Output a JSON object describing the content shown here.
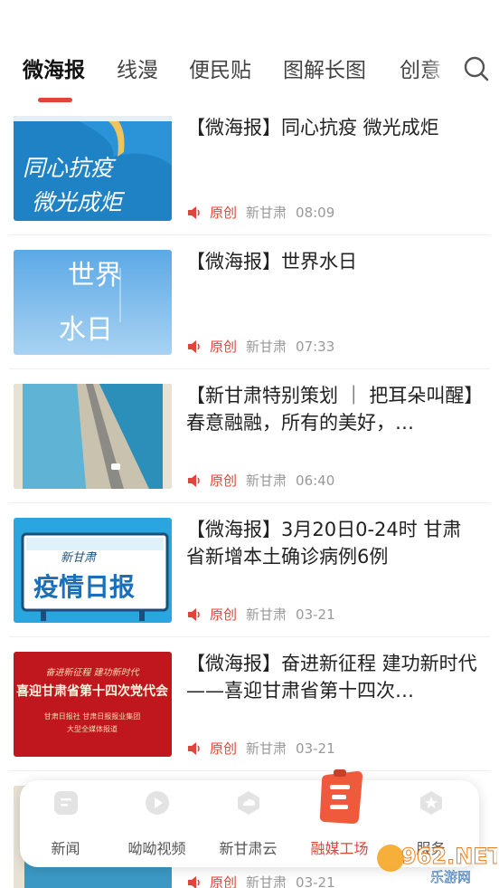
{
  "tabs": [
    {
      "label": "微海报",
      "active": true
    },
    {
      "label": "线漫"
    },
    {
      "label": "便民贴"
    },
    {
      "label": "图解长图"
    },
    {
      "label": "创意"
    }
  ],
  "feed": [
    {
      "title": "【微海报】同心抗疫  微光成炬",
      "tag": "原创",
      "source": "新甘肃",
      "time": "08:09",
      "thumb_text": [
        "同心抗疫",
        "微光成炬"
      ]
    },
    {
      "title": "【微海报】世界水日",
      "tag": "原创",
      "source": "新甘肃",
      "time": "07:33",
      "thumb_text": [
        "世界",
        "水日"
      ]
    },
    {
      "title": "【新甘肃特别策划 ｜ 把耳朵叫醒】春意融融，所有的美好，…",
      "tag": "原创",
      "source": "新甘肃",
      "time": "06:40"
    },
    {
      "title": "【微海报】3月20日0-24时 甘肃省新增本土确诊病例6例",
      "tag": "原创",
      "source": "新甘肃",
      "time": "03-21",
      "thumb_text": [
        "新甘肃",
        "疫情日报"
      ]
    },
    {
      "title": "【微海报】奋进新征程 建功新时代——喜迎甘肃省第十四次…",
      "tag": "原创",
      "source": "新甘肃",
      "time": "03-21",
      "thumb_text": [
        "奋进新征程  建功新时代",
        "喜迎甘肃省第十四次党代会",
        "甘肃日报社  甘肃日报报业集团",
        "大型全媒体报道"
      ]
    },
    {
      "title": "",
      "tag": "原创",
      "source": "新甘肃",
      "time": "03-21"
    }
  ],
  "bottom_nav": [
    {
      "label": "新闻",
      "icon": "news-icon"
    },
    {
      "label": "呦呦视频",
      "icon": "video-icon"
    },
    {
      "label": "新甘肃云",
      "icon": "cloud-icon"
    },
    {
      "label": "融媒工场",
      "icon": "media-workshop-icon",
      "active": true
    },
    {
      "label": "服务",
      "icon": "service-icon"
    }
  ],
  "watermark": {
    "brand": "962.NET",
    "text": "乐游网"
  },
  "colors": {
    "accent": "#e0443a",
    "thumb_blue": "#1f86c9"
  }
}
